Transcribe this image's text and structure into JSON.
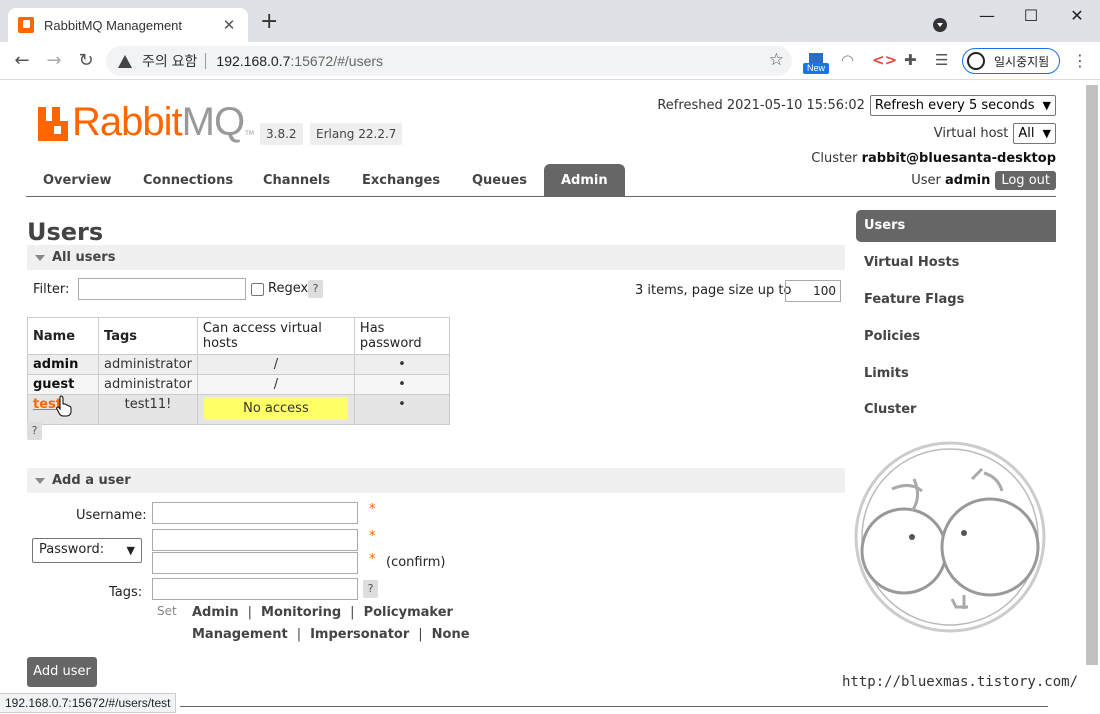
{
  "browser": {
    "tab_title": "RabbitMQ Management",
    "tab_close": "✕",
    "new_tab": "+",
    "window_controls": [
      "—",
      "☐",
      "✕"
    ],
    "security_label": "주의 요함",
    "url_host": "192.168.0.7",
    "url_rest": ":15672/#/users",
    "new_badge": "New",
    "pause_label": "일시중지됨",
    "status_url": "192.168.0.7:15672/#/users/test"
  },
  "header": {
    "logo_rabbit": "Rabbit",
    "logo_mq": "MQ",
    "logo_tm": "TM",
    "version": "3.8.2",
    "erlang": "Erlang 22.2.7",
    "refreshed_label": "Refreshed 2021-05-10 15:56:02",
    "refresh_select": "Refresh every 5 seconds",
    "vhost_label": "Virtual host",
    "vhost_select": "All",
    "cluster_label": "Cluster",
    "cluster_name": "rabbit@bluesanta-desktop",
    "user_label": "User",
    "user_name": "admin",
    "logout": "Log out"
  },
  "nav": {
    "items": [
      "Overview",
      "Connections",
      "Channels",
      "Exchanges",
      "Queues",
      "Admin"
    ],
    "active": "Admin"
  },
  "page_title": "Users",
  "all_users": {
    "title": "All users",
    "filter_label": "Filter:",
    "regex_label": "Regex",
    "help": "?",
    "items_text": "3 items, page size up to",
    "page_size": "100",
    "columns": [
      "Name",
      "Tags",
      "Can access virtual hosts",
      "Has password"
    ],
    "rows": [
      {
        "name": "admin",
        "tags": "administrator",
        "vhosts": "/",
        "password": "•"
      },
      {
        "name": "guest",
        "tags": "administrator",
        "vhosts": "/",
        "password": "•"
      },
      {
        "name": "test",
        "tags": "test11!",
        "vhosts": "No access",
        "password": "•"
      }
    ]
  },
  "add_user": {
    "title": "Add a user",
    "username_label": "Username:",
    "password_select": "Password:",
    "required": "*",
    "confirm_label": "(confirm)",
    "tags_label": "Tags:",
    "help": "?",
    "set_label": "Set",
    "tag_options": [
      "Admin",
      "Monitoring",
      "Policymaker",
      "Management",
      "Impersonator",
      "None"
    ],
    "separator": "|",
    "submit": "Add user"
  },
  "right_nav": {
    "items": [
      "Users",
      "Virtual Hosts",
      "Feature Flags",
      "Policies",
      "Limits",
      "Cluster"
    ],
    "active": "Users"
  },
  "watermark": {
    "url": "http://bluexmas.tistory.com/"
  },
  "colors": {
    "brand_orange": "#ff6600",
    "nav_gray": "#666666",
    "no_access_yellow": "#ffff66"
  }
}
